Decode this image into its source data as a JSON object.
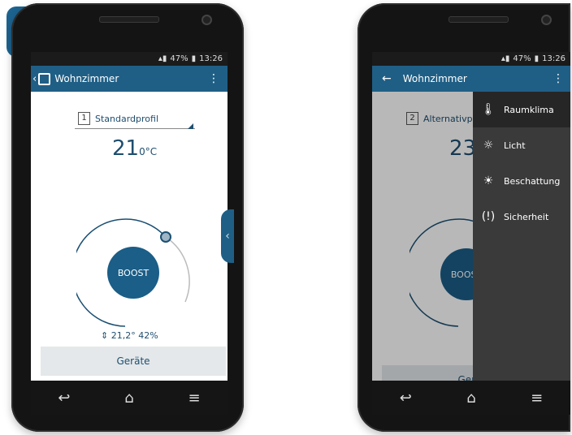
{
  "left_phone": {
    "status_bar": {
      "signal": "",
      "battery_percent": "47%",
      "time": "13:26"
    },
    "app_bar": {
      "title": "Wohnzimmer"
    },
    "profile": {
      "number": "1",
      "name": "Standardprofil"
    },
    "temperature": {
      "value": "21",
      "unit": "0°C"
    },
    "boost_label": "BOOST",
    "current_reading": "21,2° 42%",
    "devices_button": "Geräte"
  },
  "right_phone": {
    "status_bar": {
      "signal": "",
      "battery_percent": "47%",
      "time": "13:26"
    },
    "app_bar": {
      "title": "Wohnzimmer"
    },
    "profile": {
      "number": "2",
      "name": "Alternativp"
    },
    "temperature": {
      "value": "23"
    },
    "boost_label": "BOOST",
    "devices_button": "Geräte",
    "drawer_items": [
      {
        "label": "Raumklima",
        "icon": "thermometer-icon"
      },
      {
        "label": "Licht",
        "icon": "light-bulb-icon"
      },
      {
        "label": "Beschattung",
        "icon": "shading-icon"
      },
      {
        "label": "Sicherheit",
        "icon": "security-alert-icon"
      }
    ]
  },
  "colors": {
    "primary": "#1f5f86",
    "accent": "#1b5e87",
    "drawer": "#3a3a3a"
  }
}
